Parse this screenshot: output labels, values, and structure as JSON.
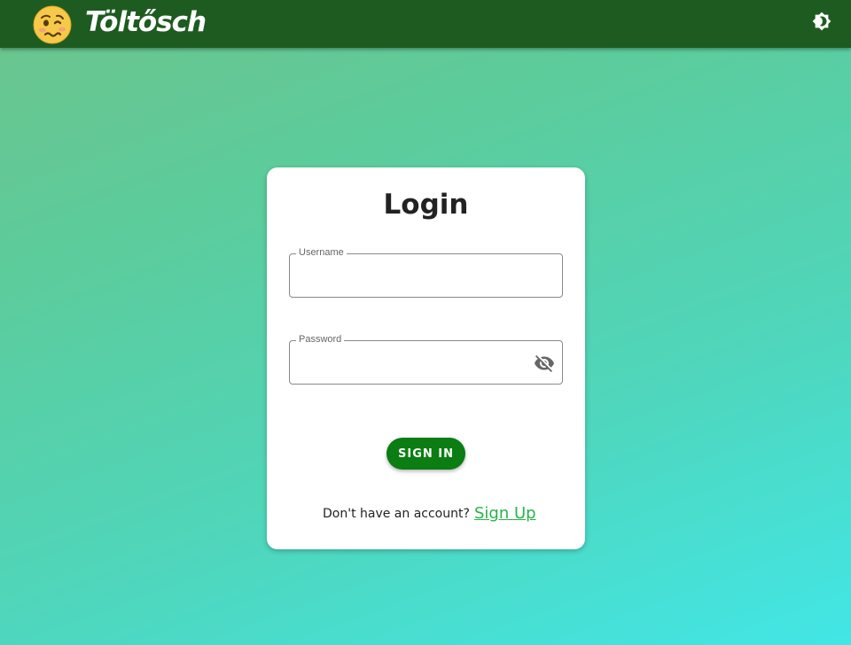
{
  "app": {
    "brand": "Töltősch",
    "logo_icon": "woozy-face-icon",
    "theme_toggle_icon": "brightness-icon"
  },
  "colors": {
    "appbar": "#1e5b20",
    "primary_button": "#0b7d12",
    "link": "#27b34a",
    "background_start": "#6cc48c",
    "background_end": "#42e6e6"
  },
  "login": {
    "title": "Login",
    "username": {
      "label": "Username",
      "value": ""
    },
    "password": {
      "label": "Password",
      "value": "",
      "toggle_icon": "eye-off-icon"
    },
    "submit_label": "SIGN IN",
    "signup_prompt": "Don't have an account?",
    "signup_link": "Sign Up"
  }
}
